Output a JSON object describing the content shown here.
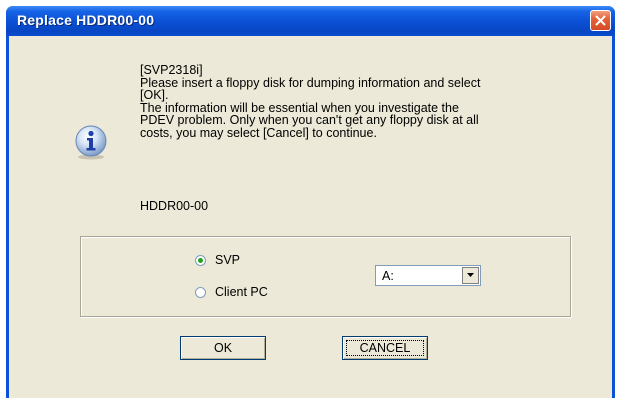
{
  "window": {
    "title": "Replace HDDR00-00"
  },
  "message": {
    "lines": [
      "[SVP2318i]",
      "Please insert a floppy disk for dumping information and select",
      "[OK].",
      "The information will be essential when you investigate the",
      "PDEV problem. Only when you can't get any floppy disk at all",
      "costs, you may select [Cancel] to continue."
    ]
  },
  "device_label": "HDDR00-00",
  "options": {
    "radio_svp": "SVP",
    "radio_client_pc": "Client PC",
    "selected": "SVP"
  },
  "drive_select": {
    "value": "A:"
  },
  "buttons": {
    "ok": "OK",
    "cancel": "CANCEL"
  },
  "colors": {
    "titlebar": "#0a4fd4",
    "dialog_background": "#ece9d8",
    "close_button": "#d44a24"
  },
  "icons": {
    "main": "info-icon",
    "close": "close-icon",
    "dropdown": "chevron-down-icon"
  }
}
